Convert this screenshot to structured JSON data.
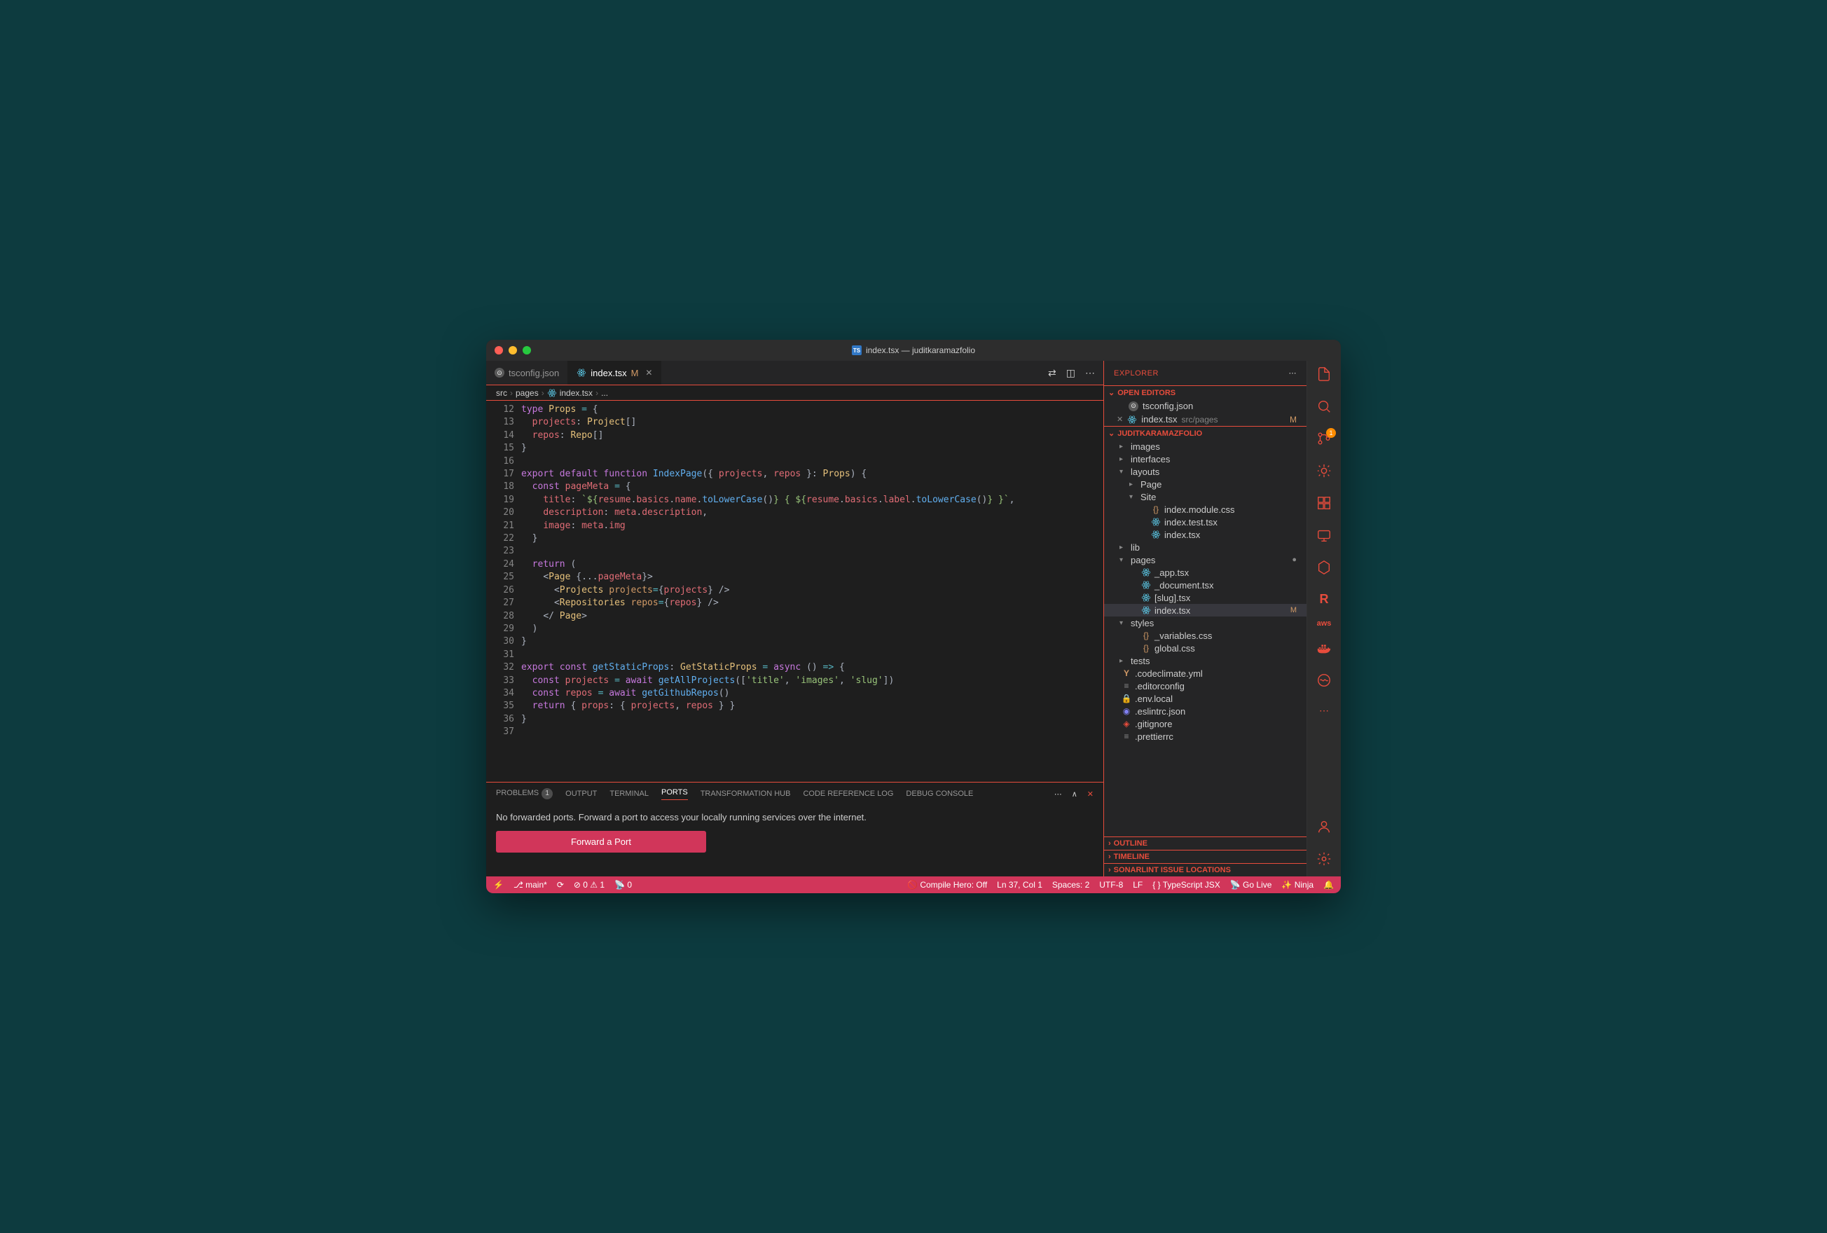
{
  "window": {
    "title": "index.tsx — juditkaramazfolio"
  },
  "tabs": [
    {
      "label": "tsconfig.json",
      "icon": "json",
      "active": false,
      "dirty": false
    },
    {
      "label": "index.tsx",
      "icon": "react",
      "active": true,
      "dirty": false,
      "status": "M"
    }
  ],
  "breadcrumb": [
    "src",
    "pages",
    "index.tsx",
    "..."
  ],
  "code_lines": [
    {
      "n": 12,
      "html": "<span class='kw'>type</span> <span class='ty'>Props</span> <span class='op'>=</span> <span class='pu'>{</span>"
    },
    {
      "n": 13,
      "html": "  <span class='va'>projects</span><span class='pu'>:</span> <span class='ty'>Project</span><span class='pu'>[]</span>"
    },
    {
      "n": 14,
      "html": "  <span class='va'>repos</span><span class='pu'>:</span> <span class='ty'>Repo</span><span class='pu'>[]</span>"
    },
    {
      "n": 15,
      "html": "<span class='pu'>}</span>"
    },
    {
      "n": 16,
      "html": ""
    },
    {
      "n": 17,
      "html": "<span class='kw'>export</span> <span class='kw'>default</span> <span class='kw'>function</span> <span class='fn'>IndexPage</span><span class='pu'>({</span> <span class='va'>projects</span><span class='pu'>,</span> <span class='va'>repos</span> <span class='pu'>}:</span> <span class='ty'>Props</span><span class='pu'>) {</span>"
    },
    {
      "n": 18,
      "html": "  <span class='kw'>const</span> <span class='va'>pageMeta</span> <span class='op'>=</span> <span class='pu'>{</span>"
    },
    {
      "n": 19,
      "html": "    <span class='va'>title</span><span class='pu'>:</span> <span class='st'>`${</span><span class='va'>resume</span><span class='pu'>.</span><span class='va'>basics</span><span class='pu'>.</span><span class='va'>name</span><span class='pu'>.</span><span class='fn'>toLowerCase</span><span class='pu'>()</span><span class='st'>} { ${</span><span class='va'>resume</span><span class='pu'>.</span><span class='va'>basics</span><span class='pu'>.</span><span class='va'>label</span><span class='pu'>.</span><span class='fn'>toLowerCase</span><span class='pu'>()</span><span class='st'>} }`</span><span class='pu'>,</span>"
    },
    {
      "n": 20,
      "html": "    <span class='va'>description</span><span class='pu'>:</span> <span class='va'>meta</span><span class='pu'>.</span><span class='va'>description</span><span class='pu'>,</span>"
    },
    {
      "n": 21,
      "html": "    <span class='va'>image</span><span class='pu'>:</span> <span class='va'>meta</span><span class='pu'>.</span><span class='va'>img</span>"
    },
    {
      "n": 22,
      "html": "  <span class='pu'>}</span>"
    },
    {
      "n": 23,
      "html": ""
    },
    {
      "n": 24,
      "html": "  <span class='kw'>return</span> <span class='pu'>(</span>"
    },
    {
      "n": 25,
      "html": "    <span class='pu'>&lt;</span><span class='ty'>Page</span> <span class='pu'>{...</span><span class='va'>pageMeta</span><span class='pu'>}&gt;</span>"
    },
    {
      "n": 26,
      "html": "      <span class='pu'>&lt;</span><span class='ty'>Projects</span> <span class='pr'>projects</span><span class='op'>=</span><span class='pu'>{</span><span class='va'>projects</span><span class='pu'>} /&gt;</span>"
    },
    {
      "n": 27,
      "html": "      <span class='pu'>&lt;</span><span class='ty'>Repositories</span> <span class='pr'>repos</span><span class='op'>=</span><span class='pu'>{</span><span class='va'>repos</span><span class='pu'>} /&gt;</span>"
    },
    {
      "n": 28,
      "html": "    <span class='pu'>&lt;/ </span><span class='ty'>Page</span><span class='pu'>&gt;</span>"
    },
    {
      "n": 29,
      "html": "  <span class='pu'>)</span>"
    },
    {
      "n": 30,
      "html": "<span class='pu'>}</span>"
    },
    {
      "n": 31,
      "html": ""
    },
    {
      "n": 32,
      "html": "<span class='kw'>export</span> <span class='kw'>const</span> <span class='fn'>getStaticProps</span><span class='pu'>:</span> <span class='ty'>GetStaticProps</span> <span class='op'>=</span> <span class='kw'>async</span> <span class='pu'>() </span><span class='op'>=&gt;</span><span class='pu'> {</span>"
    },
    {
      "n": 33,
      "html": "  <span class='kw'>const</span> <span class='va'>projects</span> <span class='op'>=</span> <span class='kw'>await</span> <span class='fn'>getAllProjects</span><span class='pu'>([</span><span class='st'>'title'</span><span class='pu'>, </span><span class='st'>'images'</span><span class='pu'>, </span><span class='st'>'slug'</span><span class='pu'>])</span>"
    },
    {
      "n": 34,
      "html": "  <span class='kw'>const</span> <span class='va'>repos</span> <span class='op'>=</span> <span class='kw'>await</span> <span class='fn'>getGithubRepos</span><span class='pu'>()</span>"
    },
    {
      "n": 35,
      "html": "  <span class='kw'>return</span> <span class='pu'>{ </span><span class='va'>props</span><span class='pu'>: { </span><span class='va'>projects</span><span class='pu'>, </span><span class='va'>repos</span><span class='pu'> } }</span>"
    },
    {
      "n": 36,
      "html": "<span class='pu'>}</span>"
    },
    {
      "n": 37,
      "html": ""
    }
  ],
  "panel": {
    "tabs": [
      "PROBLEMS",
      "OUTPUT",
      "TERMINAL",
      "PORTS",
      "TRANSFORMATION HUB",
      "CODE REFERENCE LOG",
      "DEBUG CONSOLE"
    ],
    "problems_count": "1",
    "active": "PORTS",
    "ports_text": "No forwarded ports. Forward a port to access your locally running services over the internet.",
    "forward_btn": "Forward a Port"
  },
  "explorer": {
    "header": "EXPLORER",
    "open_editors_label": "OPEN EDITORS",
    "open_editors": [
      {
        "label": "tsconfig.json",
        "icon": "json"
      },
      {
        "label": "index.tsx",
        "icon": "react",
        "sub": "src/pages",
        "status": "M",
        "close": true
      }
    ],
    "project_label": "JUDITKARAMAZFOLIO",
    "tree": [
      {
        "depth": 1,
        "chev": "▸",
        "label": "images",
        "type": "folder"
      },
      {
        "depth": 1,
        "chev": "▸",
        "label": "interfaces",
        "type": "folder"
      },
      {
        "depth": 1,
        "chev": "▾",
        "label": "layouts",
        "type": "folder"
      },
      {
        "depth": 2,
        "chev": "▸",
        "label": "Page",
        "type": "folder"
      },
      {
        "depth": 2,
        "chev": "▾",
        "label": "Site",
        "type": "folder"
      },
      {
        "depth": 3,
        "chev": "",
        "label": "index.module.css",
        "icon": "css"
      },
      {
        "depth": 3,
        "chev": "",
        "label": "index.test.tsx",
        "icon": "react"
      },
      {
        "depth": 3,
        "chev": "",
        "label": "index.tsx",
        "icon": "react"
      },
      {
        "depth": 1,
        "chev": "▸",
        "label": "lib",
        "type": "folder"
      },
      {
        "depth": 1,
        "chev": "▾",
        "label": "pages",
        "type": "folder",
        "dot": true
      },
      {
        "depth": 2,
        "chev": "",
        "label": "_app.tsx",
        "icon": "react"
      },
      {
        "depth": 2,
        "chev": "",
        "label": "_document.tsx",
        "icon": "react"
      },
      {
        "depth": 2,
        "chev": "",
        "label": "[slug].tsx",
        "icon": "react"
      },
      {
        "depth": 2,
        "chev": "",
        "label": "index.tsx",
        "icon": "react",
        "status": "M",
        "selected": true
      },
      {
        "depth": 1,
        "chev": "▾",
        "label": "styles",
        "type": "folder"
      },
      {
        "depth": 2,
        "chev": "",
        "label": "_variables.css",
        "icon": "css"
      },
      {
        "depth": 2,
        "chev": "",
        "label": "global.css",
        "icon": "css"
      },
      {
        "depth": 1,
        "chev": "▸",
        "label": "tests",
        "type": "folder"
      },
      {
        "depth": 0,
        "chev": "",
        "label": ".codeclimate.yml",
        "icon": "yml"
      },
      {
        "depth": 0,
        "chev": "",
        "label": ".editorconfig",
        "icon": "cfg"
      },
      {
        "depth": 0,
        "chev": "",
        "label": ".env.local",
        "icon": "lock"
      },
      {
        "depth": 0,
        "chev": "",
        "label": ".eslintrc.json",
        "icon": "eslint"
      },
      {
        "depth": 0,
        "chev": "",
        "label": ".gitignore",
        "icon": "git"
      },
      {
        "depth": 0,
        "chev": "",
        "label": ".prettierrc",
        "icon": "cfg"
      }
    ],
    "sections": [
      "OUTLINE",
      "TIMELINE",
      "SONARLINT ISSUE LOCATIONS"
    ]
  },
  "statusbar": {
    "branch": "main*",
    "sync": "⟳",
    "errors": "0",
    "warnings": "1",
    "radio": "0",
    "compile": "Compile Hero: Off",
    "cursor": "Ln 37, Col 1",
    "spaces": "Spaces: 2",
    "encoding": "UTF-8",
    "eol": "LF",
    "lang": "TypeScript JSX",
    "golive": "Go Live",
    "ninja": "Ninja"
  },
  "activity": {
    "scm_badge": "1"
  }
}
